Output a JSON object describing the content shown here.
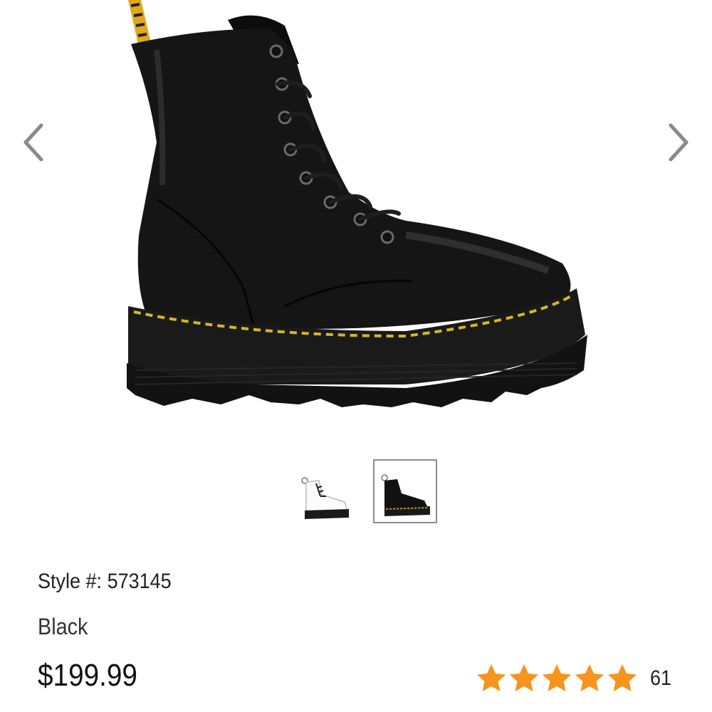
{
  "product": {
    "image_alt": "Black leather 8-eye platform boot with yellow welt stitching",
    "style_label": "Style #:",
    "style_number": "573145",
    "color_name": "Black",
    "price": "$199.99"
  },
  "gallery": {
    "prev_icon": "chevron-left-icon",
    "next_icon": "chevron-right-icon",
    "thumbnails": [
      {
        "color": "White",
        "selected": false
      },
      {
        "color": "Black",
        "selected": true
      }
    ]
  },
  "rating": {
    "value": 5,
    "max": 5,
    "review_count": "61",
    "star_color": "#f7941d"
  },
  "colors": {
    "accent_star": "#f7941d",
    "thumb_border": "#8d8d8d",
    "arrow": "#8a8a8a"
  }
}
